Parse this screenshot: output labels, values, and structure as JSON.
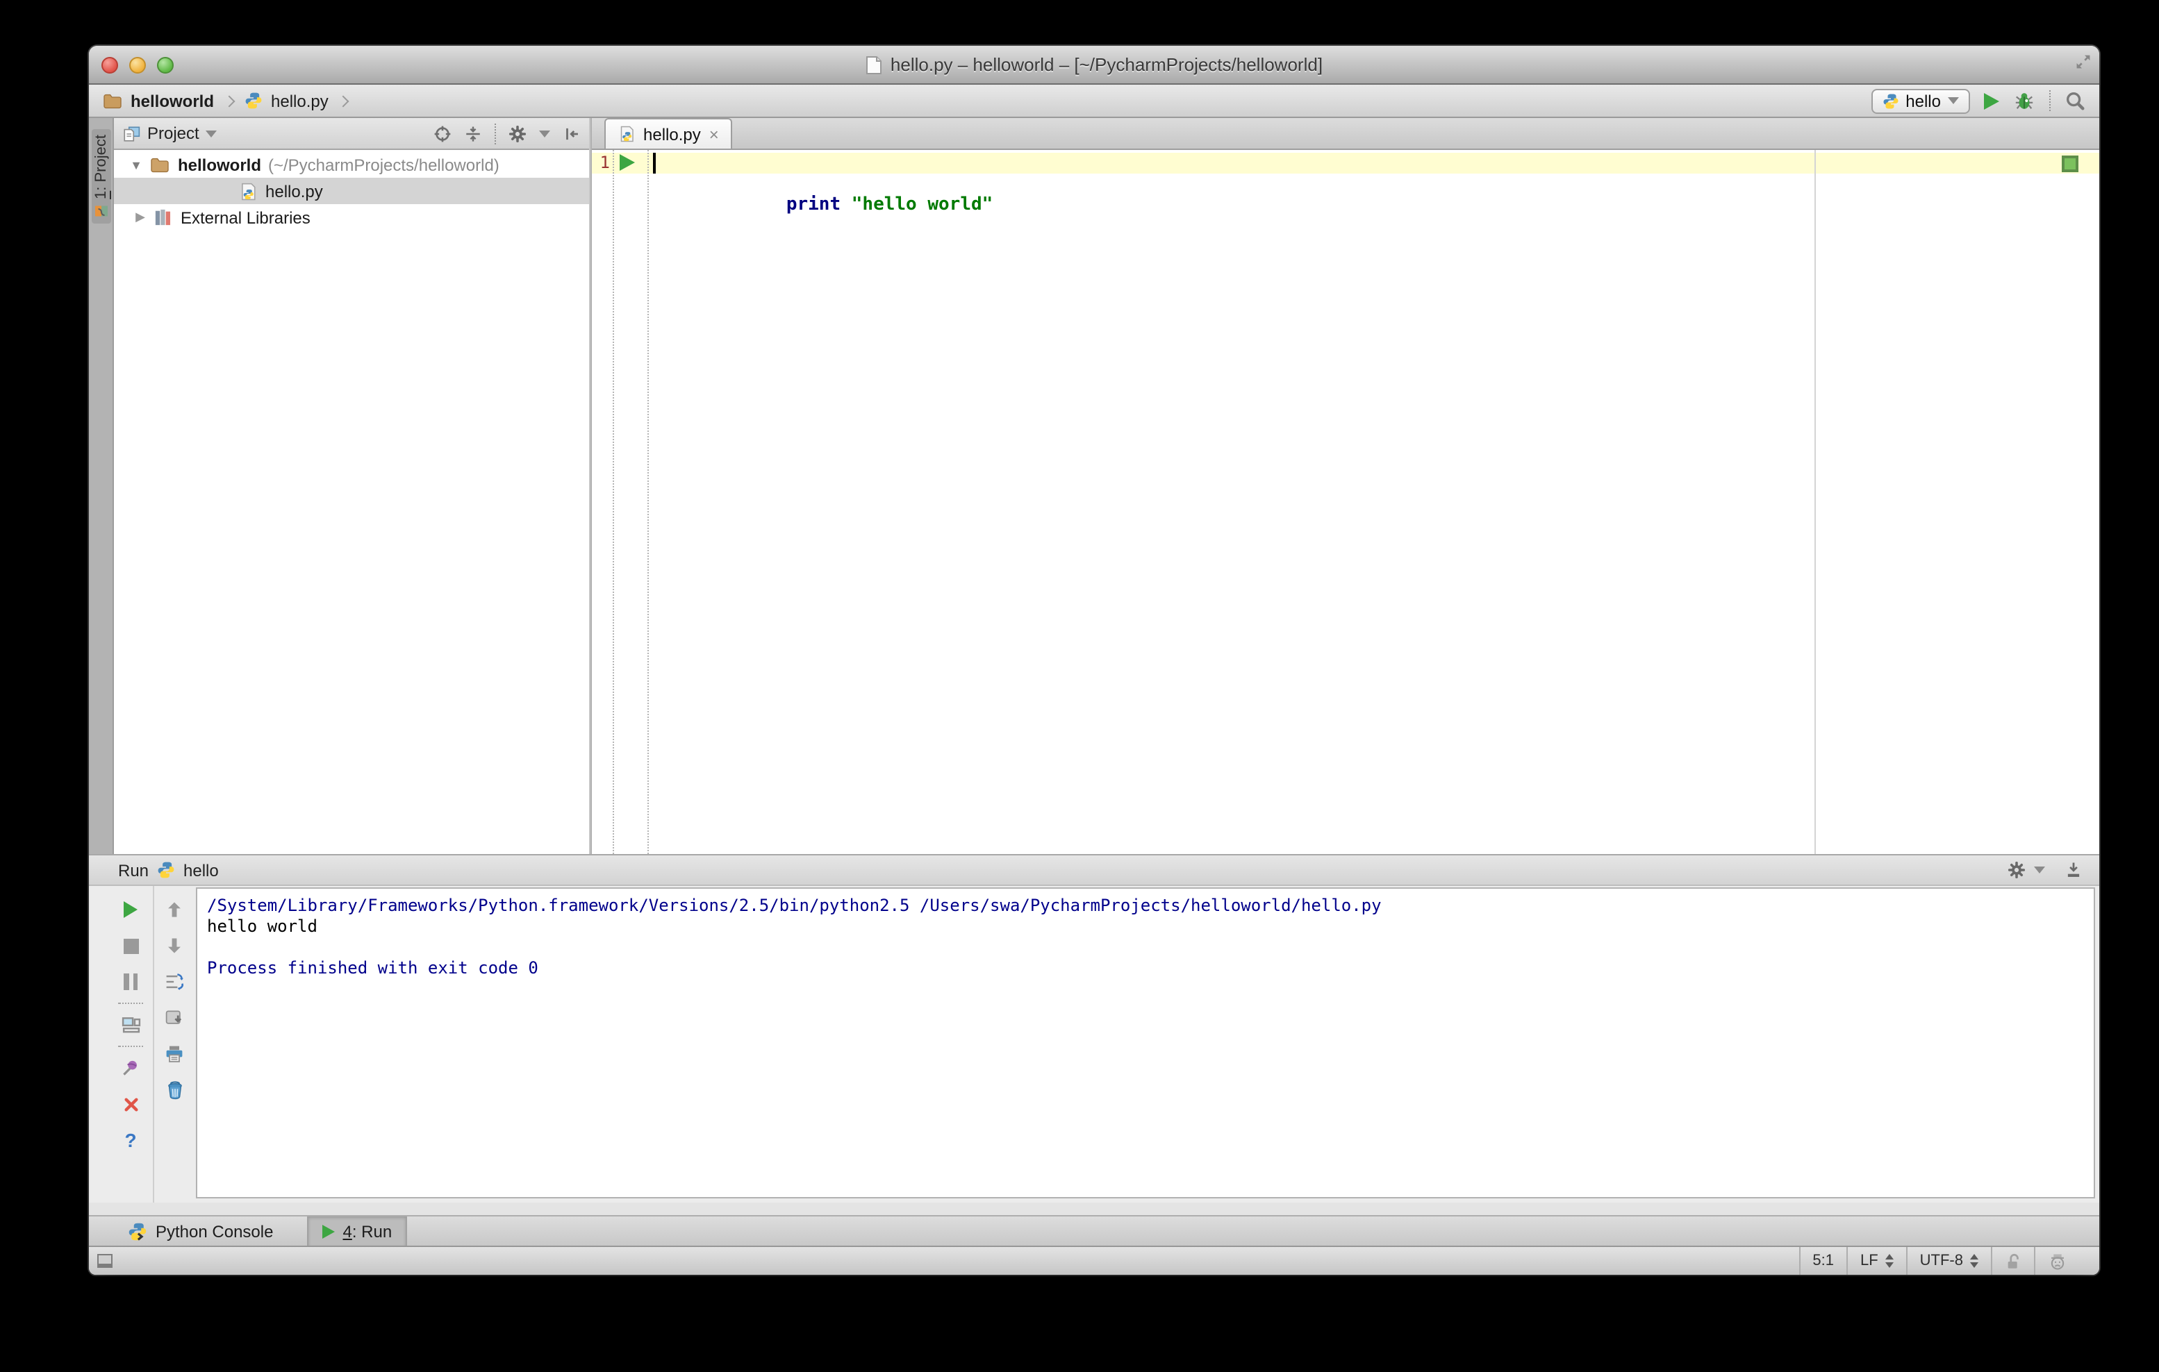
{
  "window": {
    "title": "hello.py – helloworld – [~/PycharmProjects/helloworld]"
  },
  "navbar": {
    "breadcrumb_project": "helloworld",
    "breadcrumb_file": "hello.py",
    "run_config_name": "hello"
  },
  "project_panel": {
    "tool_tab_number": "1",
    "tool_tab_suffix": ": Project",
    "header_label": "Project",
    "root_name": "helloworld",
    "root_path": "(~/PycharmProjects/helloworld)",
    "file_name": "hello.py",
    "external_libraries": "External Libraries"
  },
  "editor": {
    "tab_label": "hello.py",
    "line_number": "1",
    "code_keyword": "print",
    "code_string": "\"hello world\""
  },
  "run_panel": {
    "title": "Run",
    "config_name": "hello",
    "console_line_1": "/System/Library/Frameworks/Python.framework/Versions/2.5/bin/python2.5 /Users/swa/PycharmProjects/helloworld/hello.py",
    "console_line_2": "hello world",
    "console_line_3": "Process finished with exit code 0"
  },
  "bottom_bar": {
    "python_console_label": "Python Console",
    "run_tab_number": "4",
    "run_tab_suffix": ": Run"
  },
  "status_bar": {
    "caret_position": "5:1",
    "line_separator": "LF",
    "encoding": "UTF-8"
  },
  "icons": {
    "expanded_arrow": "▼",
    "collapsed_arrow": "▶",
    "help_glyph": "?",
    "close_tab_glyph": "×"
  },
  "colors": {
    "run_green": "#3DA642",
    "debug_green": "#43A047",
    "caret_row_yellow": "#FFFDD1",
    "keyword_blue": "#000080",
    "string_green": "#007A00",
    "console_system_blue": "#00008B",
    "inspection_ok_green": "#7CC15E"
  }
}
